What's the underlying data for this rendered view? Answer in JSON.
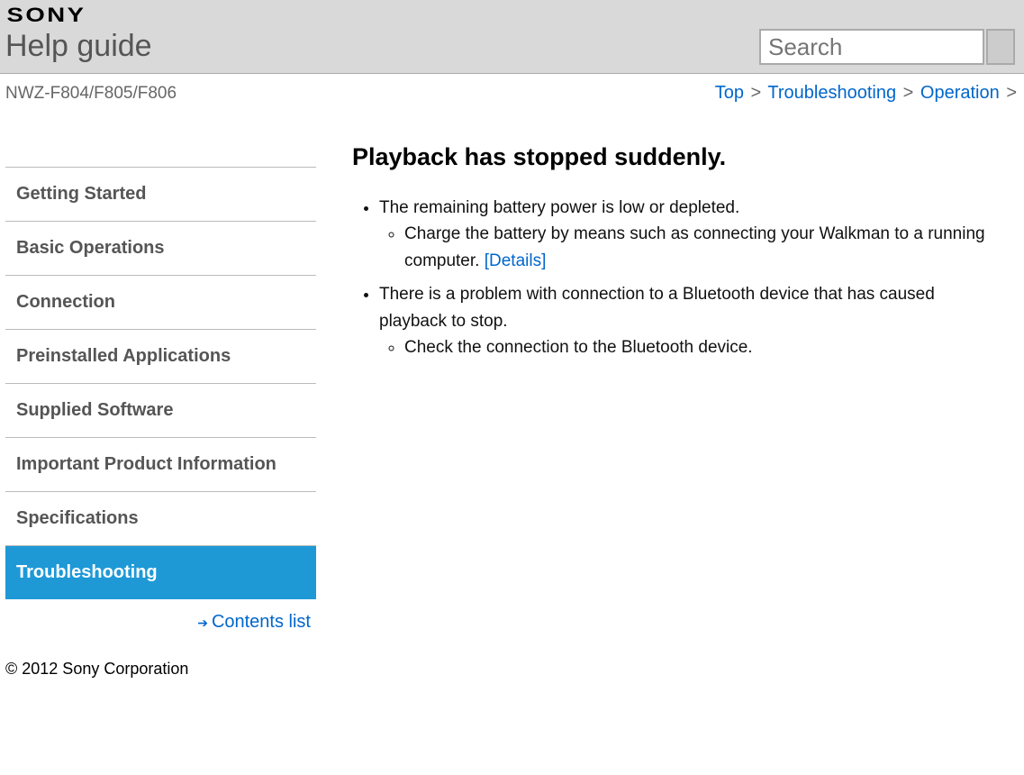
{
  "logo": "SONY",
  "help_title": "Help guide",
  "search": {
    "placeholder": "Search"
  },
  "model": "NWZ-F804/F805/F806",
  "breadcrumb": {
    "top": "Top",
    "troubleshooting": "Troubleshooting",
    "operation": "Operation",
    "sep": ">"
  },
  "sidebar": {
    "items": [
      "Getting Started",
      "Basic Operations",
      "Connection",
      "Preinstalled Applications",
      "Supplied Software",
      "Important Product Information",
      "Specifications",
      "Troubleshooting"
    ],
    "contents_list": "Contents list"
  },
  "article": {
    "title": "Playback has stopped suddenly.",
    "b1": "The remaining battery power is low or depleted.",
    "b1a": "Charge the battery by means such as connecting your Walkman to a running computer. ",
    "details": "[Details]",
    "b2": "There is a problem with connection to a Bluetooth device that has caused playback to stop.",
    "b2a": "Check the connection to the Bluetooth device."
  },
  "footer": "© 2012 Sony Corporation"
}
